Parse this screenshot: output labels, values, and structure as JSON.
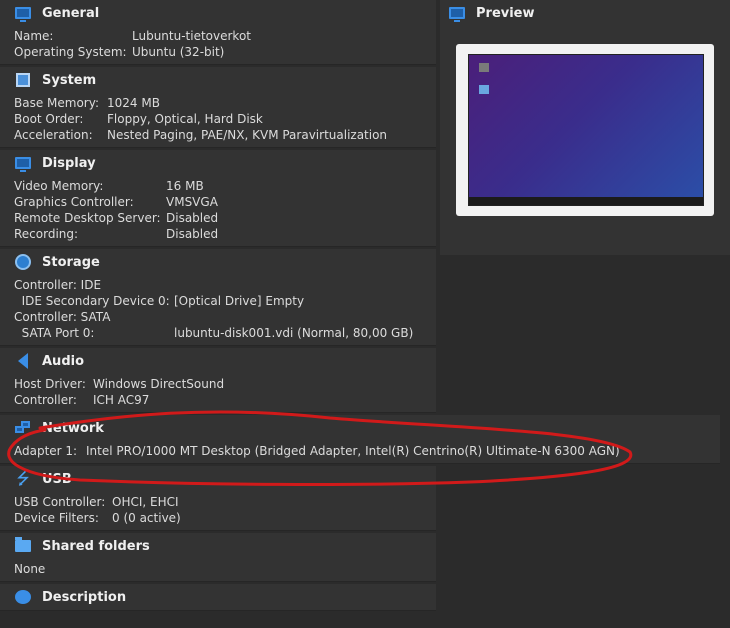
{
  "general": {
    "title": "General",
    "rows": [
      {
        "k": "Name:",
        "v": "Lubuntu-tietoverkot"
      },
      {
        "k": "Operating System:",
        "v": "Ubuntu (32-bit)"
      }
    ]
  },
  "system": {
    "title": "System",
    "rows": [
      {
        "k": "Base Memory:",
        "v": "1024 MB"
      },
      {
        "k": "Boot Order:",
        "v": "Floppy, Optical, Hard Disk"
      },
      {
        "k": "Acceleration:",
        "v": "Nested Paging, PAE/NX, KVM Paravirtualization"
      }
    ]
  },
  "display": {
    "title": "Display",
    "rows": [
      {
        "k": "Video Memory:",
        "v": "16 MB"
      },
      {
        "k": "Graphics Controller:",
        "v": "VMSVGA"
      },
      {
        "k": "Remote Desktop Server:",
        "v": "Disabled"
      },
      {
        "k": "Recording:",
        "v": "Disabled"
      }
    ]
  },
  "storage": {
    "title": "Storage",
    "rows": [
      {
        "k": "Controller: IDE",
        "v": ""
      },
      {
        "k": "  IDE Secondary Device 0:",
        "v": "[Optical Drive] Empty"
      },
      {
        "k": "Controller: SATA",
        "v": ""
      },
      {
        "k": "  SATA Port 0:",
        "v": "lubuntu-disk001.vdi (Normal, 80,00 GB)"
      }
    ]
  },
  "audio": {
    "title": "Audio",
    "rows": [
      {
        "k": "Host Driver:",
        "v": "Windows DirectSound"
      },
      {
        "k": "Controller:",
        "v": "ICH AC97"
      }
    ]
  },
  "network": {
    "title": "Network",
    "rows": [
      {
        "k": "Adapter 1:",
        "v": "Intel PRO/1000 MT Desktop (Bridged Adapter, Intel(R) Centrino(R) Ultimate-N 6300 AGN)"
      }
    ]
  },
  "usb": {
    "title": "USB",
    "rows": [
      {
        "k": "USB Controller:",
        "v": "OHCI, EHCI"
      },
      {
        "k": "Device Filters:",
        "v": "0 (0 active)"
      }
    ]
  },
  "shared_folders": {
    "title": "Shared folders",
    "rows": [
      {
        "k": "None",
        "v": ""
      }
    ]
  },
  "description": {
    "title": "Description"
  },
  "preview": {
    "title": "Preview"
  },
  "colors": {
    "annotation": "#d11a1a",
    "accent": "#3a8ee6",
    "panel": "#333333"
  }
}
